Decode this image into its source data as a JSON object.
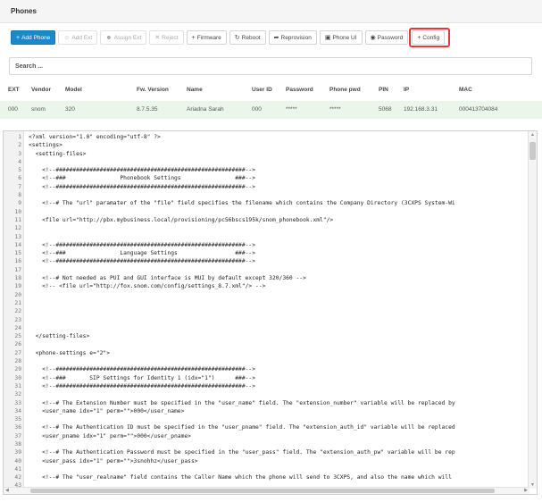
{
  "panel": {
    "title": "Phones"
  },
  "toolbar": {
    "add_phone": "Add Phone",
    "add_ext": "Add Ext",
    "assign_ext": "Assign Ext",
    "reject": "Reject",
    "firmware": "Firmware",
    "reboot": "Reboot",
    "reprovision": "Reprovision",
    "phone_ui": "Phone UI",
    "password": "Password",
    "config": "Config"
  },
  "icons": {
    "add": "plus-icon",
    "add_user": "user-plus-icon",
    "assign": "user-icon",
    "reject": "x-icon",
    "firmware": "plus-icon",
    "reboot": "refresh-icon",
    "reprovision": "share-icon",
    "phone_ui": "window-icon",
    "password": "eye-icon",
    "config": "plus-icon"
  },
  "search": {
    "placeholder": "Search ..."
  },
  "table": {
    "headers": {
      "ext": "EXT",
      "vendor": "Vendor",
      "model": "Model",
      "fw": "Fw. Version",
      "name": "Name",
      "userid": "User ID",
      "password": "Password",
      "phonepwd": "Phone pwd",
      "pin": "PIN",
      "ip": "IP",
      "mac": "MAC"
    },
    "rows": [
      {
        "ext": "000",
        "vendor": "snom",
        "model": "320",
        "fw": "8.7.5.35",
        "name": "Ariadna Sarah",
        "userid": "000",
        "password": "*****",
        "phonepwd": "*****",
        "pin": "5068",
        "ip": "192.168.3.31",
        "mac": "000413704084"
      }
    ]
  },
  "colors": {
    "primary": "#1a88c9",
    "highlight": "#e53935",
    "row_bg": "#eaf6ea"
  },
  "editor": {
    "lines": [
      {
        "n": "1",
        "t": "<?xml version=\"1.0\" encoding=\"utf-8\" ?>"
      },
      {
        "n": "2",
        "t": "<settings>"
      },
      {
        "n": "3",
        "t": "  <setting-files>"
      },
      {
        "n": "4",
        "t": ""
      },
      {
        "n": "5",
        "t": "    <!--########################################################-->"
      },
      {
        "n": "6",
        "t": "    <!--###                Phonebook Settings                ###-->"
      },
      {
        "n": "7",
        "t": "    <!--########################################################-->"
      },
      {
        "n": "8",
        "t": ""
      },
      {
        "n": "9",
        "t": "    <!--# The \"url\" paramater of the \"file\" field specifies the filename which contains the Company Directory (3CXPS System-Wi"
      },
      {
        "n": "10",
        "t": ""
      },
      {
        "n": "11",
        "t": "    <file url=\"http://pbx.mybusiness.local/provisioning/pc56bscs195k/snom_phonebook.xml\"/>"
      },
      {
        "n": "12",
        "t": ""
      },
      {
        "n": "13",
        "t": ""
      },
      {
        "n": "14",
        "t": "    <!--########################################################-->"
      },
      {
        "n": "15",
        "t": "    <!--###                Language Settings                 ###-->"
      },
      {
        "n": "16",
        "t": "    <!--########################################################-->"
      },
      {
        "n": "17",
        "t": ""
      },
      {
        "n": "18",
        "t": "    <!--# Not needed as PUI and GUI interface is MUI by default except 320/360 -->"
      },
      {
        "n": "19",
        "t": "    <!-- <file url=\"http://fox.snom.com/config/settings_8.7.xml\"/> -->"
      },
      {
        "n": "20",
        "t": ""
      },
      {
        "n": "21",
        "t": ""
      },
      {
        "n": "22",
        "t": ""
      },
      {
        "n": "23",
        "t": ""
      },
      {
        "n": "24",
        "t": ""
      },
      {
        "n": "25",
        "t": "  </setting-files>"
      },
      {
        "n": "26",
        "t": ""
      },
      {
        "n": "27",
        "t": "  <phone-settings e=\"2\">"
      },
      {
        "n": "28",
        "t": ""
      },
      {
        "n": "29",
        "t": "    <!--########################################################-->"
      },
      {
        "n": "30",
        "t": "    <!--###       SIP Settings for Identity 1 (idx=\"1\")      ###-->"
      },
      {
        "n": "31",
        "t": "    <!--########################################################-->"
      },
      {
        "n": "32",
        "t": ""
      },
      {
        "n": "33",
        "t": "    <!--# The Extension Number must be specified in the \"user_name\" field. The \"extension_number\" variable will be replaced by"
      },
      {
        "n": "34",
        "t": "    <user_name idx=\"1\" perm=\"\">000</user_name>"
      },
      {
        "n": "35",
        "t": ""
      },
      {
        "n": "36",
        "t": "    <!--# The Authentication ID must be specified in the \"user_pname\" field. The \"extension_auth_id\" variable will be replaced"
      },
      {
        "n": "37",
        "t": "    <user_pname idx=\"1\" perm=\"\">000</user_pname>"
      },
      {
        "n": "38",
        "t": ""
      },
      {
        "n": "39",
        "t": "    <!--# The Authentication Password must be specified in the \"user_pass\" field. The \"extension_auth_pw\" variable will be rep"
      },
      {
        "n": "40",
        "t": "    <user_pass idx=\"1\" perm=\"\">3snohhz</user_pass>"
      },
      {
        "n": "41",
        "t": ""
      },
      {
        "n": "42",
        "t": "    <!--# The \"user_realname\" field contains the Caller Name which the phone will send to 3CXPS, and also the name which will"
      },
      {
        "n": "43",
        "t": ""
      }
    ]
  }
}
